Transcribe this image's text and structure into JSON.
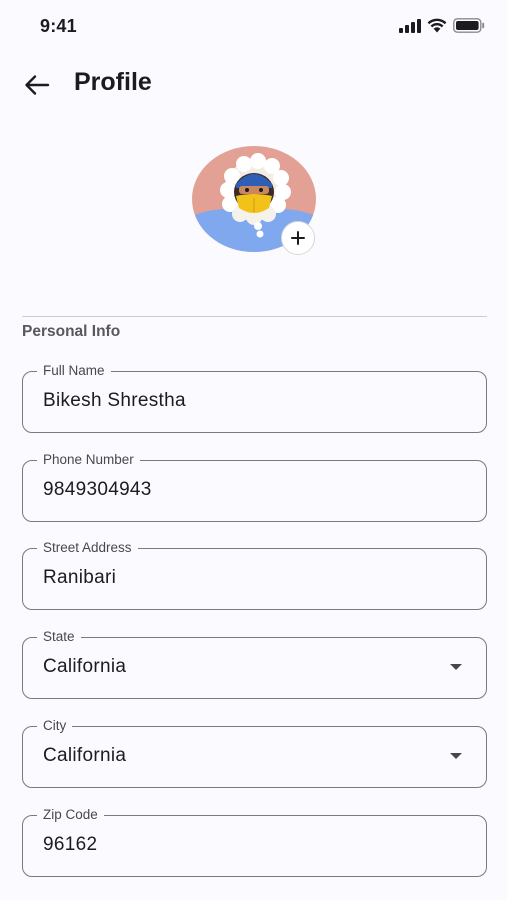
{
  "status_bar": {
    "time": "9:41"
  },
  "header": {
    "title": "Profile",
    "back_icon": "arrow-back-icon"
  },
  "avatar": {
    "add_icon": "plus-icon"
  },
  "section": {
    "title": "Personal Info"
  },
  "fields": [
    {
      "label": "Full Name",
      "value": "Bikesh Shrestha",
      "type": "text"
    },
    {
      "label": "Phone Number",
      "value": "9849304943",
      "type": "text"
    },
    {
      "label": "Street Address",
      "value": "Ranibari",
      "type": "text"
    },
    {
      "label": "State",
      "value": "California",
      "type": "dropdown"
    },
    {
      "label": "City",
      "value": "California",
      "type": "dropdown"
    },
    {
      "label": "Zip Code",
      "value": "96162",
      "type": "text"
    }
  ],
  "colors": {
    "background": "#fbfafe",
    "outline": "#7b787e",
    "text": "#1c1b1f",
    "section_title": "#5a575e",
    "avatar_bg_top": "#e3a195",
    "avatar_bg_bottom": "#7fa8ef"
  }
}
